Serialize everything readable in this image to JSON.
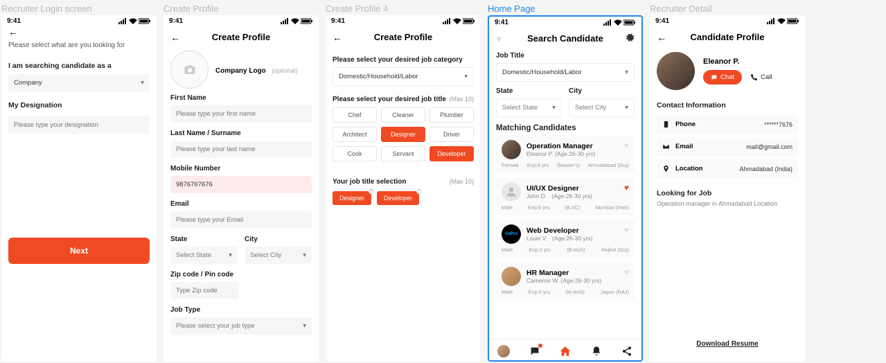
{
  "status_time": "9:41",
  "screens": {
    "s1": {
      "label": "Recruiter Login screen",
      "prompt": "Please select what are you looking for",
      "heading": "I am searching candidate as a",
      "role_select": "Company",
      "designation_label": "My Designation",
      "designation_placeholder": "Please type your designation",
      "next_btn": "Next"
    },
    "s2": {
      "label": "Create Profile",
      "title": "Create Profile",
      "logo_label": "Company Logo",
      "logo_opt": "(optional)",
      "first_name_label": "First Name",
      "first_name_ph": "Please type your first name",
      "last_name_label": "Last Name / Surname",
      "last_name_ph": "Please type your last name",
      "mobile_label": "Mobile Number",
      "mobile_val": "9876767676",
      "email_label": "Email",
      "email_ph": "Please type your Email",
      "state_label": "State",
      "state_ph": "Select State",
      "city_label": "City",
      "city_ph": "Select City",
      "zip_label": "Zip code /  Pin code",
      "zip_ph": "Type Zip code",
      "jobtype_label": "Job Type",
      "jobtype_ph": "Please select your job type"
    },
    "s3": {
      "label": "Create Profile 4",
      "title": "Create Profile",
      "cat_label": "Please select your desired job category",
      "cat_val": "Domestic/Household/Labor",
      "title_label": "Please select your desired job title",
      "max": "(Max 10)",
      "chips": [
        "Chef",
        "Cleaner",
        "Plumber",
        "Architect",
        "Designer",
        "Driver",
        "Cook",
        "Servant",
        "Developer"
      ],
      "sel_label": "Your job title selection",
      "tags": [
        "Designer",
        "Developer"
      ]
    },
    "s4": {
      "label": "Home Page",
      "title": "Search Candidate",
      "jobtitle_label": "Job Title",
      "jobtitle_val": "Domestic/Household/Labor",
      "state_label": "State",
      "state_ph": "Select State",
      "city_label": "City",
      "city_ph": "Select City",
      "matching": "Matching Candidates",
      "candidates": [
        {
          "title": "Operation Manager",
          "name": "Eleanor P.",
          "age": "(Age:26-30 yrs)",
          "gender": "Female",
          "exp": "Exp:8 yrs",
          "edu": "(Master's)",
          "loc": "Ahmadabad (Guj)"
        },
        {
          "title": "UI/UX Designer",
          "name": "John D.",
          "age": "(Age:26-30 yrs)",
          "gender": "Male",
          "exp": "Exp:6 yrs",
          "edu": "(B.SC)",
          "loc": "Mumbai (Mah)"
        },
        {
          "title": "Web Developer",
          "name": "Louis V.",
          "age": "(Age:26-30 yrs)",
          "gender": "Male",
          "exp": "Exp:2 yrs",
          "edu": "(B.tech)",
          "loc": "Rajkot   (Guj)"
        },
        {
          "title": "HR Manager",
          "name": "Cameron W.",
          "age": "(Age:26-30 yrs)",
          "gender": "Male",
          "exp": "Exp:0 yrs",
          "edu": "(M.tech)",
          "loc": "Jaipur (RAJ)"
        }
      ]
    },
    "s5": {
      "label": "Recruiter Detail",
      "title": "Candidate Profile",
      "name": "Eleanor P.",
      "chat": "Chat",
      "call": "Call",
      "contact_label": "Contact Information",
      "phone_label": "Phone",
      "phone_val": "******7676",
      "email_label": "Email",
      "email_val": "mail@gmail.com",
      "loc_label": "Location",
      "loc_val": "Ahmadabad (India)",
      "looking_label": "Looking for Job",
      "looking_val": "Operation manager in Ahmadabad Location",
      "download": "Download Resume"
    }
  }
}
